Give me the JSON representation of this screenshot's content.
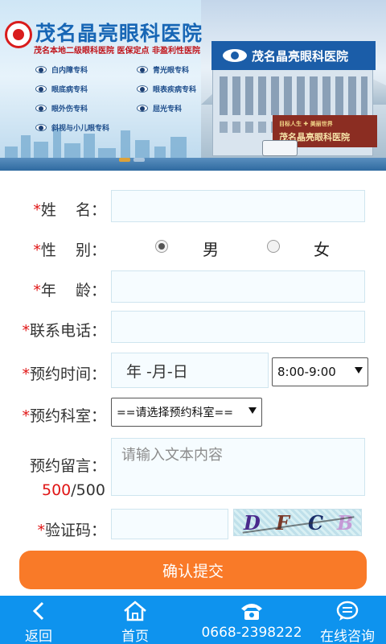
{
  "banner": {
    "hospital_name": "茂名晶亮眼科医院",
    "subtitle": "茂名本地二级眼科医院  医保定点  非盈利性医院",
    "departments_left": [
      "白内障专科",
      "眼底病专科",
      "眼外伤专科",
      "斜视与小儿眼专科"
    ],
    "departments_right": [
      "青光眼专科",
      "眼表疾病专科",
      "屈光专科"
    ],
    "building_sign": "茂名晶亮眼科医院",
    "gate_small": "目标人生 ✚ 美丽世界",
    "gate_text": "茂名晶亮眼科医院"
  },
  "form": {
    "name": {
      "required_mark": "*",
      "label": "姓    名：",
      "value": ""
    },
    "gender": {
      "required_mark": "*",
      "label": "性    别：",
      "options": [
        "男",
        "女"
      ],
      "selected": "男"
    },
    "age": {
      "required_mark": "*",
      "label": "年    龄：",
      "value": ""
    },
    "phone": {
      "required_mark": "*",
      "label": "联系电话：",
      "value": ""
    },
    "appointment_time": {
      "required_mark": "*",
      "label": "预约时间：",
      "date_placeholder": "年 -月-日",
      "time_slot": "8:00-9:00"
    },
    "department": {
      "required_mark": "*",
      "label": "预约科室：",
      "selected": "==请选择预约科室=="
    },
    "message": {
      "label": "预约留言：",
      "placeholder": "请输入文本内容",
      "counter_current": "500",
      "counter_max": "/500"
    },
    "captcha": {
      "required_mark": "*",
      "label": "验证码：",
      "value": "",
      "chars": [
        "D",
        "F",
        "C",
        "B"
      ]
    },
    "submit_label": "确认提交"
  },
  "bottom_nav": {
    "back": "返回",
    "home": "首页",
    "phone": "0668-2398222",
    "consult": "在线咨询"
  },
  "colors": {
    "primary_blue": "#0e93ee",
    "submit_orange": "#f97a28",
    "required_red": "#e01515",
    "input_bg": "#f6fcff"
  }
}
